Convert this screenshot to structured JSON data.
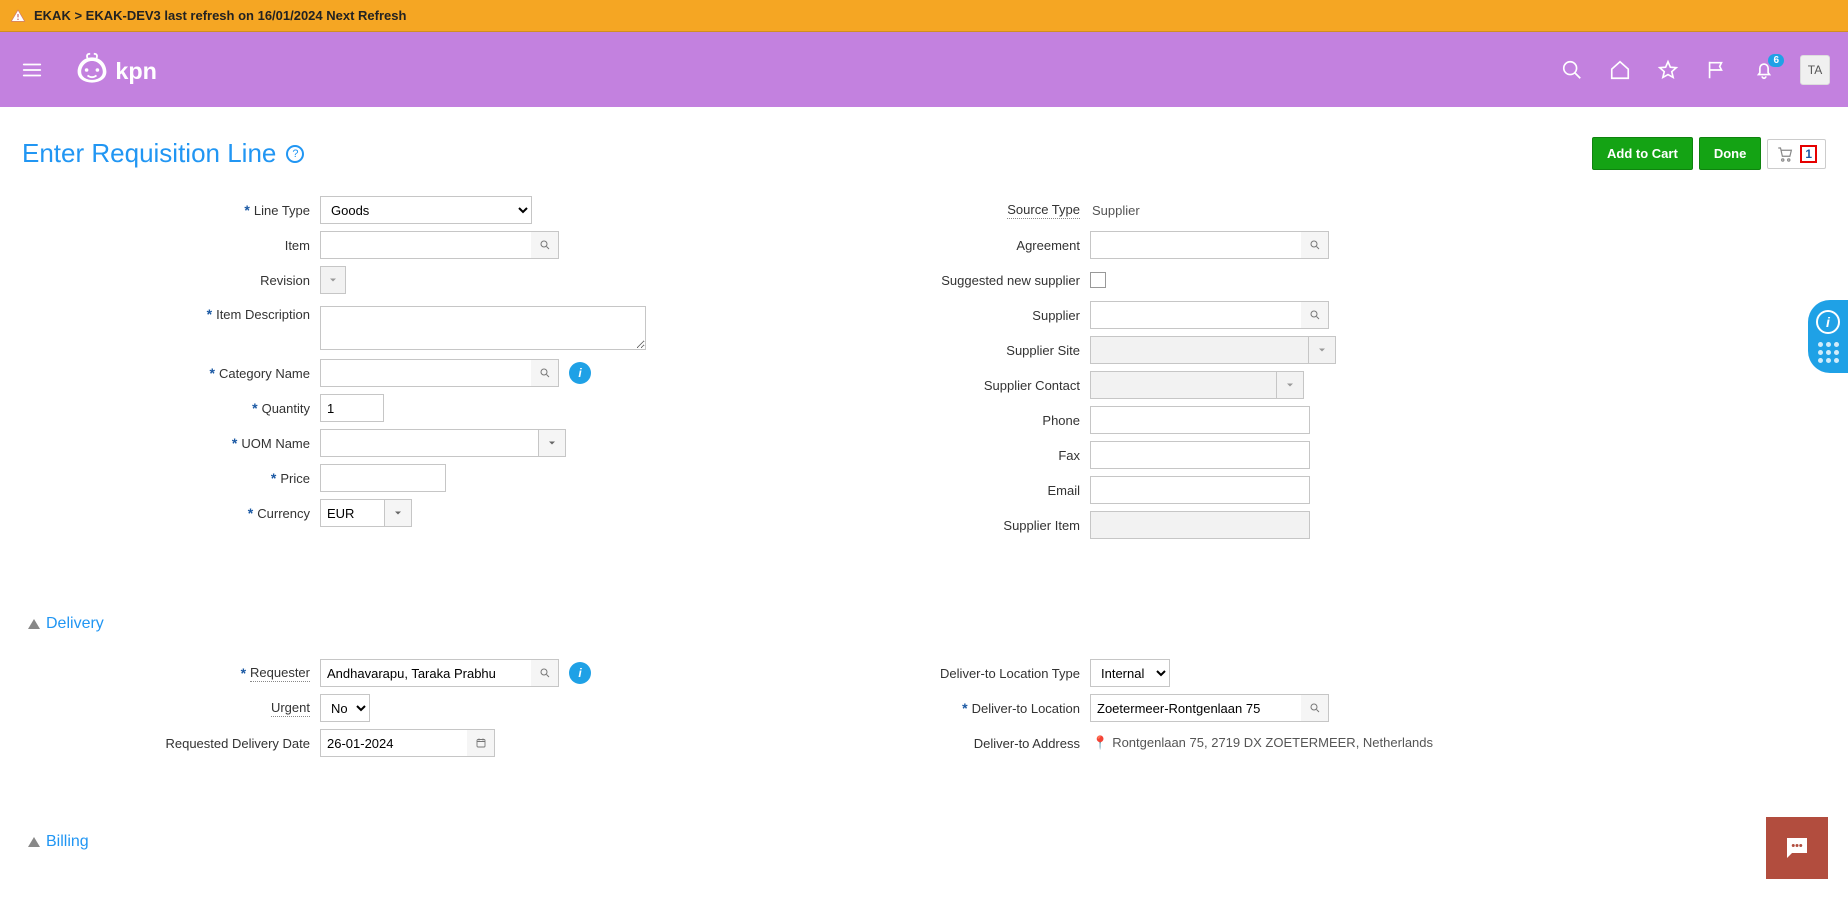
{
  "banner": {
    "text": "EKAK > EKAK-DEV3 last refresh on 16/01/2024 Next Refresh"
  },
  "header": {
    "logo_text": "kpn",
    "notifications": "6",
    "avatar": "TA"
  },
  "page": {
    "title": "Enter Requisition Line"
  },
  "actions": {
    "add_to_cart": "Add to Cart",
    "done": "Done",
    "cart_count": "1"
  },
  "form": {
    "line_type": {
      "label": "Line Type",
      "value": "Goods"
    },
    "item": {
      "label": "Item",
      "value": ""
    },
    "revision": {
      "label": "Revision",
      "value": ""
    },
    "item_description": {
      "label": "Item Description",
      "value": ""
    },
    "category_name": {
      "label": "Category Name",
      "value": ""
    },
    "quantity": {
      "label": "Quantity",
      "value": "1"
    },
    "uom_name": {
      "label": "UOM Name",
      "value": ""
    },
    "price": {
      "label": "Price",
      "value": ""
    },
    "currency": {
      "label": "Currency",
      "value": "EUR"
    },
    "source_type": {
      "label": "Source Type",
      "value": "Supplier"
    },
    "agreement": {
      "label": "Agreement",
      "value": ""
    },
    "suggested_new_supplier": {
      "label": "Suggested new supplier",
      "value": ""
    },
    "supplier": {
      "label": "Supplier",
      "value": ""
    },
    "supplier_site": {
      "label": "Supplier Site",
      "value": ""
    },
    "supplier_contact": {
      "label": "Supplier Contact",
      "value": ""
    },
    "phone": {
      "label": "Phone",
      "value": ""
    },
    "fax": {
      "label": "Fax",
      "value": ""
    },
    "email": {
      "label": "Email",
      "value": ""
    },
    "supplier_item": {
      "label": "Supplier Item",
      "value": ""
    }
  },
  "sections": {
    "delivery": "Delivery",
    "billing": "Billing"
  },
  "delivery": {
    "requester": {
      "label": "Requester",
      "value": "Andhavarapu, Taraka Prabhu"
    },
    "urgent": {
      "label": "Urgent",
      "value": "No"
    },
    "requested_delivery_date": {
      "label": "Requested Delivery Date",
      "value": "26-01-2024"
    },
    "deliver_to_location_type": {
      "label": "Deliver-to Location Type",
      "value": "Internal"
    },
    "deliver_to_location": {
      "label": "Deliver-to Location",
      "value": "Zoetermeer-Rontgenlaan 75"
    },
    "deliver_to_address": {
      "label": "Deliver-to Address",
      "value": "Rontgenlaan 75, 2719 DX ZOETERMEER, Netherlands"
    }
  }
}
